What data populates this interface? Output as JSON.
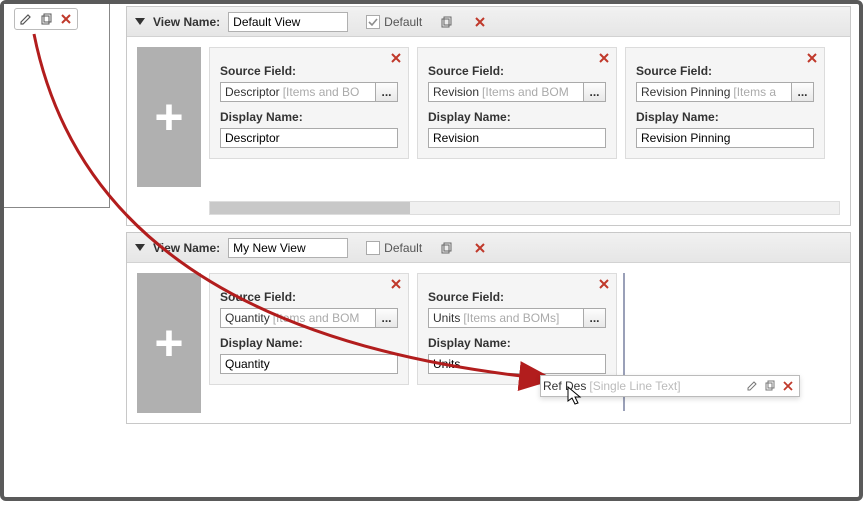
{
  "labels": {
    "view_name": "View Name:",
    "default": "Default",
    "source_field": "Source Field:",
    "display_name": "Display Name:",
    "picker": "..."
  },
  "views": [
    {
      "name": "Default View",
      "is_default": true,
      "cards": [
        {
          "source_name": "Descriptor",
          "source_hint": "[Items and BO",
          "display": "Descriptor"
        },
        {
          "source_name": "Revision",
          "source_hint": "[Items and BOM",
          "display": "Revision"
        },
        {
          "source_name": "Revision Pinning",
          "source_hint": "[Items a",
          "display": "Revision Pinning"
        }
      ]
    },
    {
      "name": "My New View",
      "is_default": false,
      "cards": [
        {
          "source_name": "Quantity",
          "source_hint": "[Items and BOM",
          "display": "Quantity"
        },
        {
          "source_name": "Units",
          "source_hint": "[Items and BOMs]",
          "display": "Units"
        }
      ]
    }
  ],
  "drag": {
    "name": "Ref Des",
    "hint": "[Single Line Text]"
  }
}
